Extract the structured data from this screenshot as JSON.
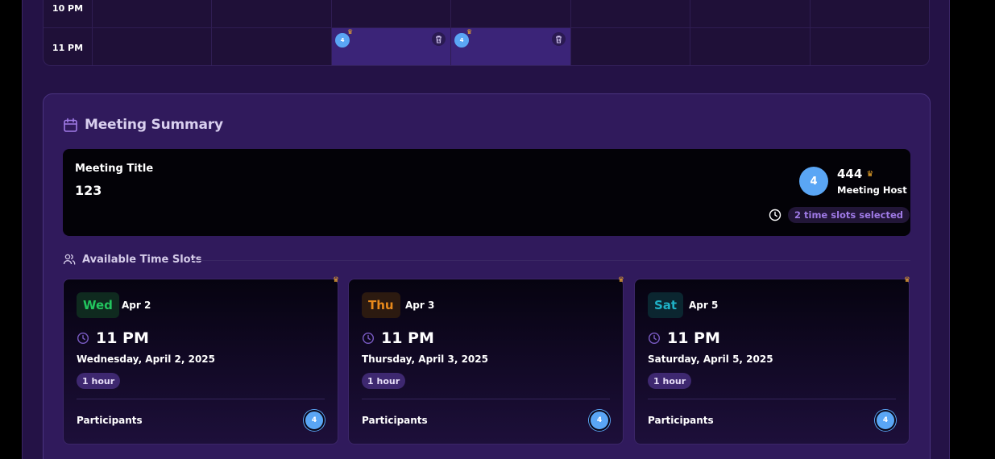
{
  "calendar": {
    "rows": [
      {
        "time": "10 PM"
      },
      {
        "time": "11 PM"
      }
    ],
    "selected_slots": [
      {
        "participant_count": "4"
      },
      {
        "participant_count": "4"
      }
    ]
  },
  "summary": {
    "title": "Meeting Summary",
    "meeting_title_label": "Meeting Title",
    "meeting_title_value": "123",
    "host": {
      "avatar": "4",
      "name": "444",
      "role": "Meeting Host"
    },
    "slots_selected": "2 time slots selected",
    "available_heading": "Available Time Slots",
    "slots": [
      {
        "day": "Wed",
        "date": "Apr 2",
        "time": "11 PM",
        "full_date": "Wednesday, April 2, 2025",
        "duration": "1 hour",
        "participants_label": "Participants",
        "participant_avatar": "4",
        "day_color": "#22c55e",
        "day_bg": "#0f2a1f"
      },
      {
        "day": "Thu",
        "date": "Apr 3",
        "time": "11 PM",
        "full_date": "Thursday, April 3, 2025",
        "duration": "1 hour",
        "participants_label": "Participants",
        "participant_avatar": "4",
        "day_color": "#e8891b",
        "day_bg": "#2c1a10"
      },
      {
        "day": "Sat",
        "date": "Apr 5",
        "time": "11 PM",
        "full_date": "Saturday, April 5, 2025",
        "duration": "1 hour",
        "participants_label": "Participants",
        "participant_avatar": "4",
        "day_color": "#1fb1c6",
        "day_bg": "#0b2630"
      }
    ]
  },
  "colors": {
    "accent": "#9f7ae6",
    "avatar": "#5aa6f5",
    "crown": "#f0a92b",
    "panel": "#301a5c"
  }
}
